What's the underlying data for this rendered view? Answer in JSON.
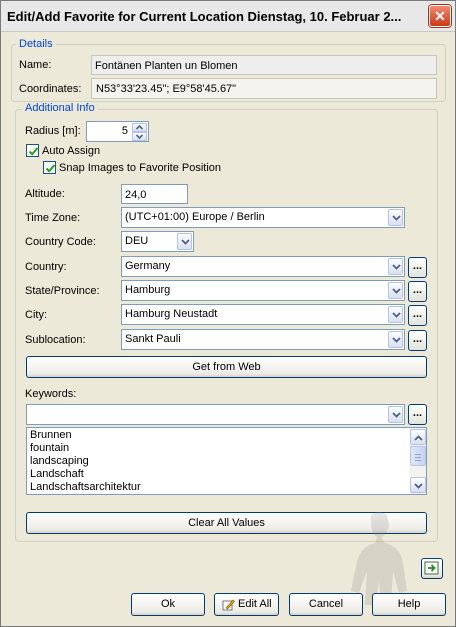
{
  "window": {
    "title": "Edit/Add Favorite for Current Location   Dienstag, 10. Februar 2...",
    "close_glyph": "✕"
  },
  "details": {
    "legend": "Details",
    "name_label": "Name:",
    "name_value": "Fontänen Planten un Blomen",
    "coordinates_label": "Coordinates:",
    "coordinates_value": "N53°33'23.45\"; E9°58'45.67\""
  },
  "additional": {
    "legend": "Additional Info",
    "radius_label": "Radius [m]:",
    "radius_value": "5",
    "auto_assign_label": "Auto Assign",
    "auto_assign_checked": true,
    "snap_label": "Snap Images to Favorite Position",
    "snap_checked": true,
    "altitude_label": "Altitude:",
    "altitude_value": "24,0",
    "timezone_label": "Time Zone:",
    "timezone_value": "(UTC+01:00) Europe / Berlin",
    "country_code_label": "Country Code:",
    "country_code_value": "DEU",
    "country_label": "Country:",
    "country_value": "Germany",
    "state_label": "State/Province:",
    "state_value": "Hamburg",
    "city_label": "City:",
    "city_value": "Hamburg Neustadt",
    "sublocation_label": "Sublocation:",
    "sublocation_value": "Sankt Pauli",
    "ellipsis": "...",
    "get_from_web": "Get from Web",
    "keywords_label": "Keywords:",
    "keywords_value": "",
    "keywords_list": [
      "Brunnen",
      "fountain",
      "landscaping",
      "Landschaft",
      "Landschaftsarchitektur"
    ],
    "clear_all": "Clear All Values"
  },
  "footer": {
    "ok": "Ok",
    "edit_all": "Edit All",
    "cancel": "Cancel",
    "help": "Help"
  },
  "icons": {
    "close": "close-icon",
    "dropdown": "chevron-down-icon",
    "edit_all": "pencil-icon",
    "side_tool": "export-icon",
    "watermark": "person-silhouette-icon"
  }
}
